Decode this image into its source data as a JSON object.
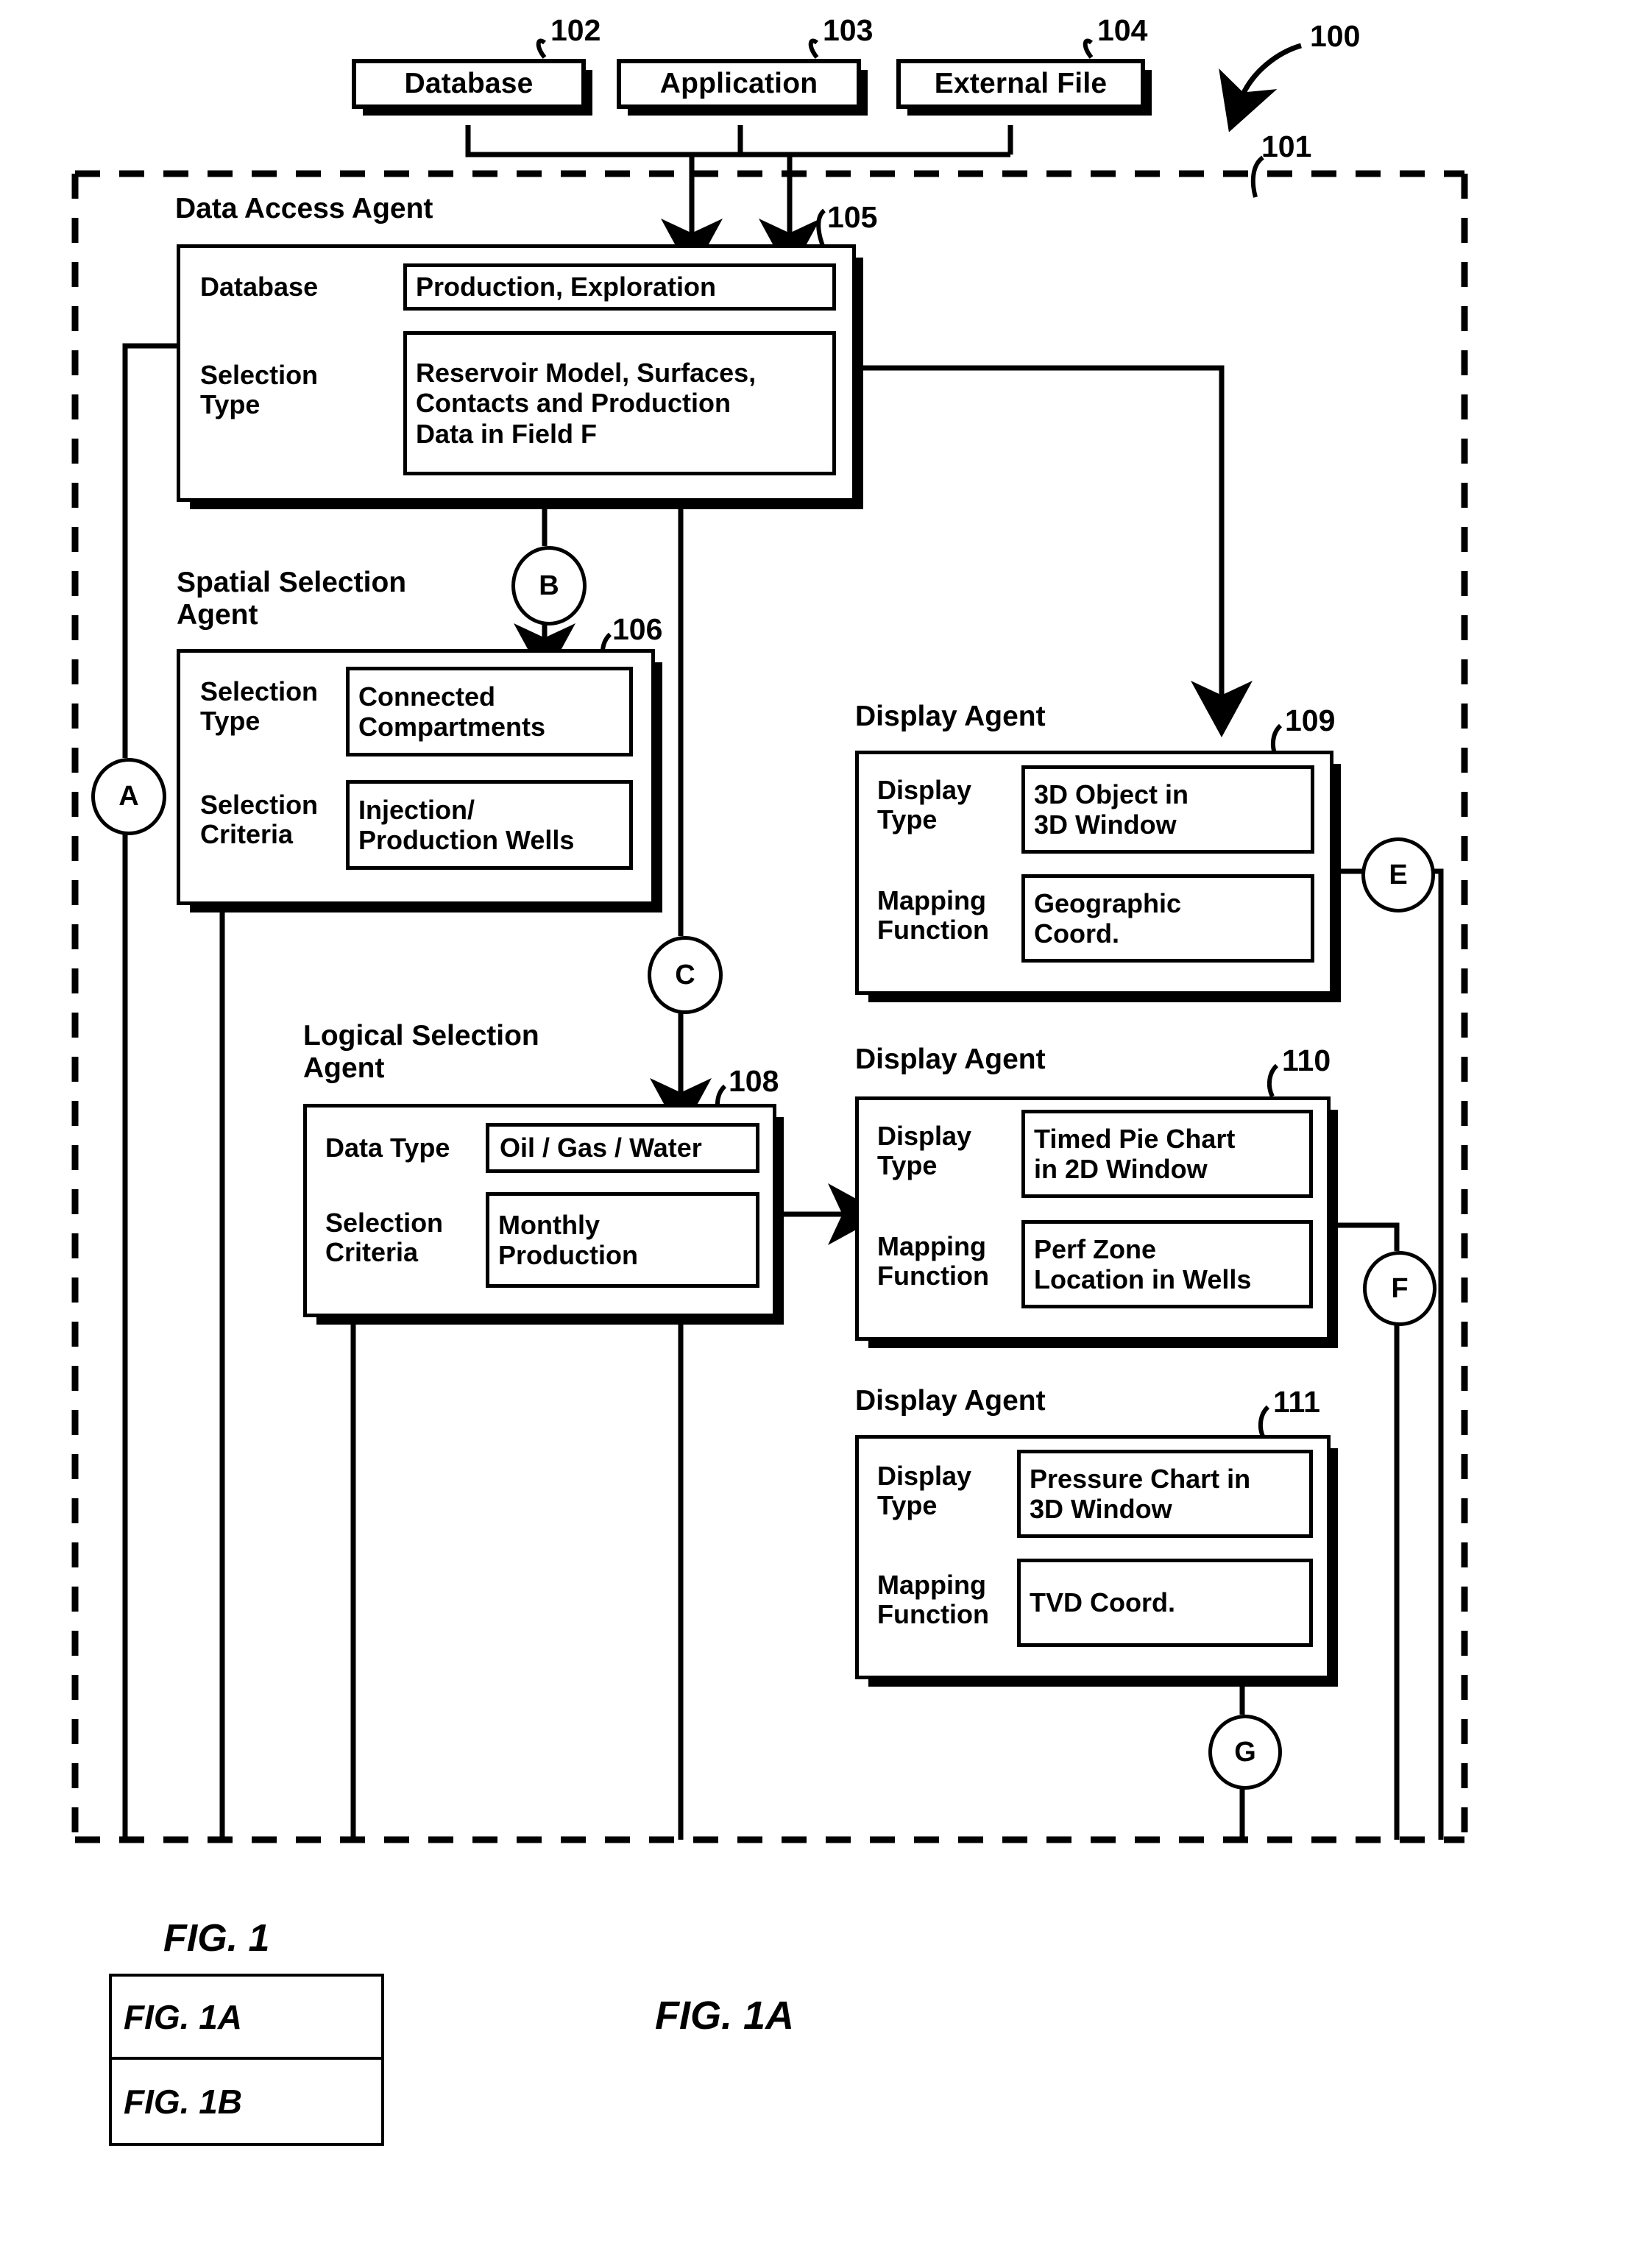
{
  "figure": {
    "number_100": "100",
    "number_101": "101",
    "caption_main": "FIG. 1",
    "caption_right": "FIG. 1A",
    "sheet_rows": [
      "FIG. 1A",
      "FIG. 1B"
    ]
  },
  "sources": [
    {
      "label": "Database",
      "ref": "102"
    },
    {
      "label": "Application",
      "ref": "103"
    },
    {
      "label": "External File",
      "ref": "104"
    }
  ],
  "agents": {
    "data_access": {
      "title": "Data Access Agent",
      "ref": "105",
      "rows": [
        {
          "label": "Database",
          "value": "Production, Exploration"
        },
        {
          "label": "Selection\nType",
          "value": "Reservoir Model, Surfaces,\nContacts and Production\nData in Field F"
        }
      ]
    },
    "spatial_selection": {
      "title": "Spatial Selection\nAgent",
      "ref": "106",
      "rows": [
        {
          "label": "Selection\nType",
          "value": "Connected\nCompartments"
        },
        {
          "label": "Selection\nCriteria",
          "value": "Injection/\nProduction Wells"
        }
      ]
    },
    "logical_selection": {
      "title": "Logical Selection\nAgent",
      "ref": "108",
      "rows": [
        {
          "label": "Data Type",
          "value": "Oil / Gas / Water"
        },
        {
          "label": "Selection\nCriteria",
          "value": "Monthly\nProduction"
        }
      ]
    },
    "display_109": {
      "title": "Display Agent",
      "ref": "109",
      "rows": [
        {
          "label": "Display\nType",
          "value": "3D Object in\n3D Window"
        },
        {
          "label": "Mapping\nFunction",
          "value": "Geographic\nCoord."
        }
      ]
    },
    "display_110": {
      "title": "Display Agent",
      "ref": "110",
      "rows": [
        {
          "label": "Display\nType",
          "value": "Timed Pie Chart\nin 2D Window"
        },
        {
          "label": "Mapping\nFunction",
          "value": "Perf Zone\nLocation in Wells"
        }
      ]
    },
    "display_111": {
      "title": "Display Agent",
      "ref": "111",
      "rows": [
        {
          "label": "Display\nType",
          "value": "Pressure Chart in\n3D Window"
        },
        {
          "label": "Mapping\nFunction",
          "value": "TVD Coord."
        }
      ]
    }
  },
  "connectors": [
    {
      "id": "A",
      "label": "A"
    },
    {
      "id": "B",
      "label": "B"
    },
    {
      "id": "C",
      "label": "C"
    },
    {
      "id": "E",
      "label": "E"
    },
    {
      "id": "F",
      "label": "F"
    },
    {
      "id": "G",
      "label": "G"
    }
  ]
}
